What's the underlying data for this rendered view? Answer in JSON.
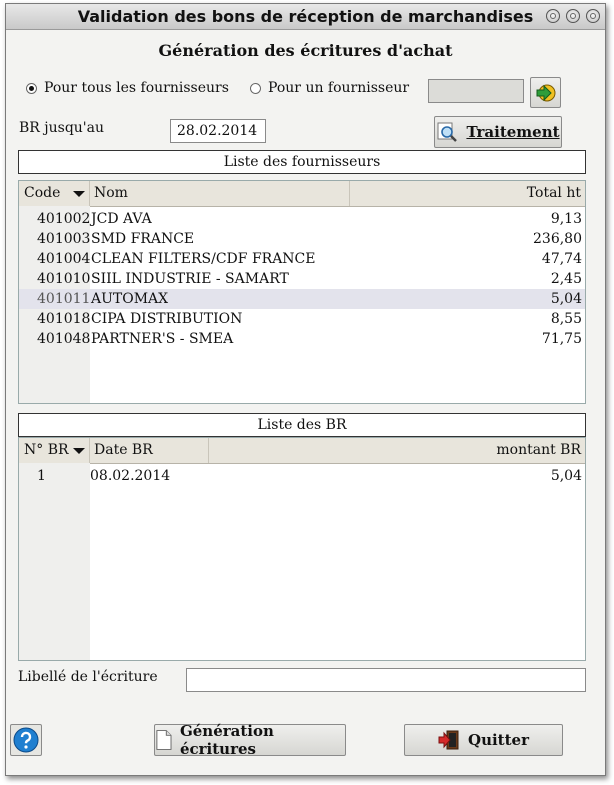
{
  "window": {
    "title": "Validation des bons de réception de marchandises"
  },
  "heading": "Génération des écritures d'achat",
  "options": {
    "all_suppliers": "Pour tous les fournisseurs",
    "one_supplier": "Pour un fournisseur",
    "selected": "all_suppliers",
    "supplier_value": ""
  },
  "br_until": {
    "label": "BR jusqu'au",
    "value": "28.02.2014"
  },
  "buttons": {
    "traitement": "Traitement",
    "generation": "Génération écritures",
    "quitter": "Quitter"
  },
  "suppliers_panel": {
    "title": "Liste des fournisseurs",
    "columns": [
      "Code",
      "Nom",
      "Total ht"
    ],
    "rows": [
      {
        "code": "401002",
        "nom": "JCD AVA",
        "total": "9,13"
      },
      {
        "code": "401003",
        "nom": "SMD FRANCE",
        "total": "236,80"
      },
      {
        "code": "401004",
        "nom": "CLEAN FILTERS/CDF FRANCE",
        "total": "47,74"
      },
      {
        "code": "401010",
        "nom": "SIIL INDUSTRIE - SAMART",
        "total": "2,45"
      },
      {
        "code": "401011",
        "nom": "AUTOMAX",
        "total": "5,04"
      },
      {
        "code": "401018",
        "nom": "CIPA DISTRIBUTION",
        "total": "8,55"
      },
      {
        "code": "401048",
        "nom": "PARTNER'S - SMEA",
        "total": "71,75"
      }
    ],
    "selected_row": 4
  },
  "br_panel": {
    "title": "Liste des BR",
    "columns": [
      "N° BR",
      "Date BR",
      "montant BR"
    ],
    "rows": [
      {
        "num": "1",
        "date": "08.02.2014",
        "montant": "5,04"
      }
    ]
  },
  "libelle": {
    "label": "Libellé de l'écriture",
    "value": ""
  },
  "colors": {
    "selection": "#e3e3ec",
    "help_icon": "#1f7fd0",
    "go_icon": "#f0c020"
  }
}
